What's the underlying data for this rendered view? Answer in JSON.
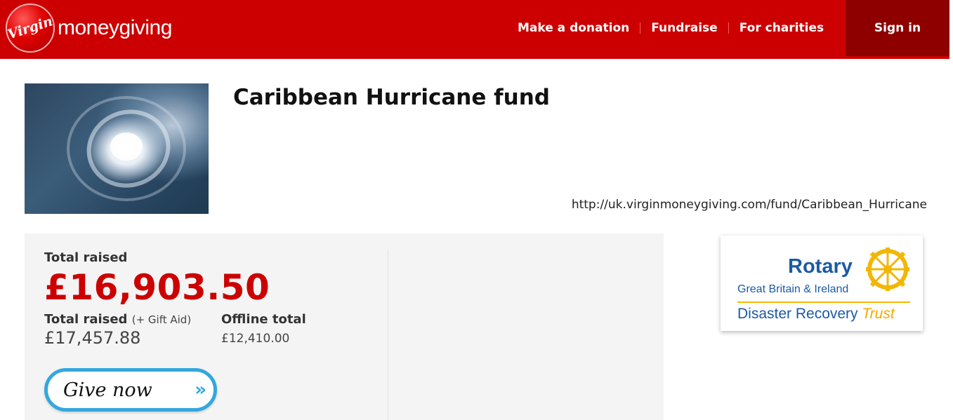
{
  "brand": {
    "badge_text": "Virgin",
    "wordmark": "moneygiving"
  },
  "nav": {
    "items": [
      "Make a donation",
      "Fundraise",
      "For charities"
    ],
    "sign_in": "Sign in"
  },
  "fund": {
    "title": "Caribbean Hurricane fund",
    "url": "http://uk.virginmoneygiving.com/fund/Caribbean_Hurricane",
    "image_alt": "satellite-hurricane-image"
  },
  "totals": {
    "total_raised_label": "Total raised",
    "total_raised_value": "£16,903.50",
    "gift_aid_label": "Total raised",
    "gift_aid_suffix": "(+ Gift Aid)",
    "gift_aid_value": "£17,457.88",
    "offline_label": "Offline total",
    "offline_value": "£12,410.00"
  },
  "give_button": {
    "label": "Give now",
    "arrow": "»"
  },
  "charity": {
    "name": "Rotary",
    "region": "Great Britain & Ireland",
    "trust_main": "Disaster Recovery",
    "trust_accent": "Trust"
  },
  "colors": {
    "header_red": "#cc0000",
    "sign_in_dark_red": "#8e0000",
    "total_red": "#cc0000",
    "give_button_blue": "#33a7de",
    "rotary_blue": "#1c5aa4",
    "rotary_gold": "#f2b705"
  }
}
